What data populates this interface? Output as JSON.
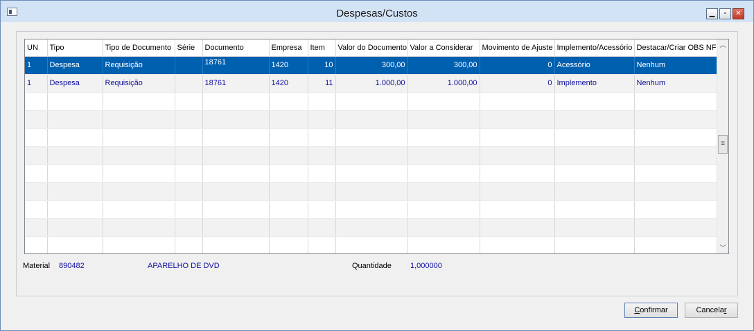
{
  "window": {
    "title": "Despesas/Custos"
  },
  "grid": {
    "columns": [
      "UN",
      "Tipo",
      "Tipo de Documento",
      "Série",
      "Documento",
      "Empresa",
      "Item",
      "Valor do Documento",
      "Valor a Considerar",
      "Movimento de Ajuste",
      "Implemento/Acessório",
      "Destacar/Criar OBS NF"
    ],
    "rows": [
      [
        "1",
        "Despesa",
        "Requisição",
        "",
        "18761",
        "1420",
        "10",
        "300,00",
        "300,00",
        "0",
        "Acessório",
        "Nenhum"
      ],
      [
        "1",
        "Despesa",
        "Requisição",
        "",
        "18761",
        "1420",
        "11",
        "1.000,00",
        "1.000,00",
        "0",
        "Implemento",
        "Nenhum"
      ]
    ],
    "selected_row": 0
  },
  "info": {
    "material_label": "Material",
    "material_code": "890482",
    "material_desc": "APARELHO DE DVD",
    "quantity_label": "Quantidade",
    "quantity_value": "1,000000"
  },
  "buttons": {
    "confirm_accel": "C",
    "confirm_rest": "onfirmar",
    "cancel_rest": "Cancela",
    "cancel_accel": "r"
  },
  "colors": {
    "selection": "#0060b0",
    "value_text": "#1010a0",
    "titlebar": "#d3e3f6"
  }
}
